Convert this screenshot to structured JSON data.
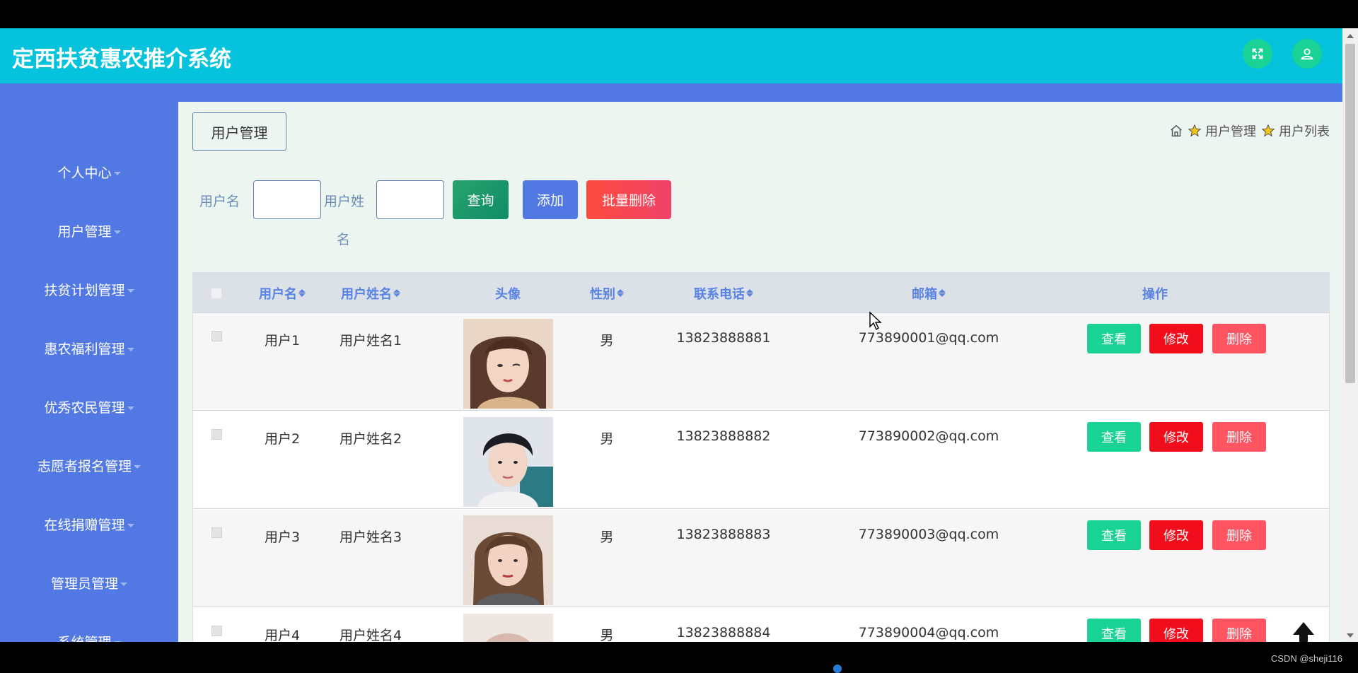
{
  "app": {
    "title": "定西扶贫惠农推介系统"
  },
  "header_icons": [
    "fullscreen-icon",
    "user-icon"
  ],
  "sidebar": {
    "items": [
      {
        "label": "个人中心"
      },
      {
        "label": "用户管理"
      },
      {
        "label": "扶贫计划管理"
      },
      {
        "label": "惠农福利管理"
      },
      {
        "label": "优秀农民管理"
      },
      {
        "label": "志愿者报名管理"
      },
      {
        "label": "在线捐赠管理"
      },
      {
        "label": "管理员管理"
      },
      {
        "label": "系统管理"
      }
    ]
  },
  "tab": {
    "label": "用户管理"
  },
  "breadcrumb": {
    "items": [
      "用户管理",
      "用户列表"
    ]
  },
  "search": {
    "username_label": "用户名",
    "realname_label_line1": "用户姓",
    "realname_label_line2": "名",
    "username_value": "",
    "realname_value": "",
    "query_label": "查询",
    "add_label": "添加",
    "batch_delete_label": "批量删除"
  },
  "table": {
    "headers": {
      "username": "用户名",
      "realname": "用户姓名",
      "avatar": "头像",
      "gender": "性别",
      "phone": "联系电话",
      "email": "邮箱",
      "actions": "操作"
    },
    "action_labels": {
      "view": "查看",
      "edit": "修改",
      "delete": "删除"
    },
    "rows": [
      {
        "username": "用户1",
        "realname": "用户姓名1",
        "gender": "男",
        "phone": "13823888881",
        "email": "773890001@qq.com"
      },
      {
        "username": "用户2",
        "realname": "用户姓名2",
        "gender": "男",
        "phone": "13823888882",
        "email": "773890002@qq.com"
      },
      {
        "username": "用户3",
        "realname": "用户姓名3",
        "gender": "男",
        "phone": "13823888883",
        "email": "773890003@qq.com"
      },
      {
        "username": "用户4",
        "realname": "用户姓名4",
        "gender": "男",
        "phone": "13823888884",
        "email": "773890004@qq.com"
      }
    ]
  },
  "watermark": "CSDN @sheji116",
  "colors": {
    "header": "#06c3dd",
    "sidebar": "#5278e4",
    "content_bg": "#edf5f1",
    "view_button": "#19d296",
    "edit_button": "#f20d1d",
    "delete_button": "#ff5563"
  }
}
